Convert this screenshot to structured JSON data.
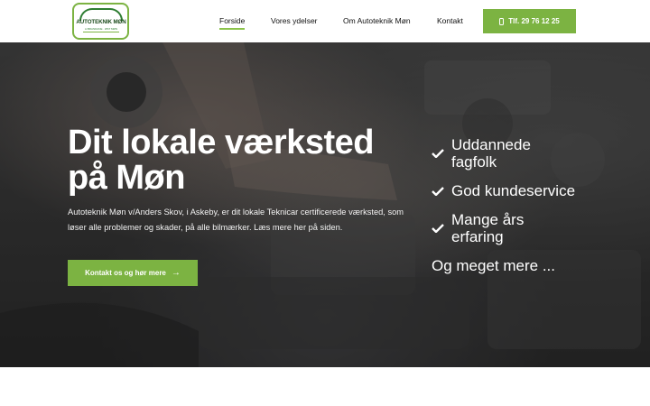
{
  "logo": {
    "name": "AUTOTEKNIK MØN",
    "tagline": "A.BRANDANE · ØST MØN"
  },
  "nav": {
    "items": [
      {
        "label": "Forside",
        "active": true
      },
      {
        "label": "Vores ydelser",
        "active": false
      },
      {
        "label": "Om Autoteknik Møn",
        "active": false
      },
      {
        "label": "Kontakt",
        "active": false
      }
    ],
    "phone_label": "Tlf. 29 76 12 25"
  },
  "hero": {
    "title": "Dit lokale værksted på Møn",
    "description": "Autoteknik Møn v/Anders Skov, i Askeby, er dit lokale Teknicar certificerede værksted, som løser alle problemer og skader, på alle bilmærker. Læs mere her på siden.",
    "cta_label": "Kontakt os og hør mere",
    "features": [
      "Uddannede fagfolk",
      "God kundeservice",
      "Mange års erfaring"
    ],
    "more": "Og meget mere ..."
  },
  "colors": {
    "accent": "#7cb342",
    "text_dark": "#111111",
    "hero_text": "#ffffff"
  },
  "icons": {
    "phone": "phone-icon",
    "arrow": "arrow-right-icon",
    "check": "check-icon"
  }
}
